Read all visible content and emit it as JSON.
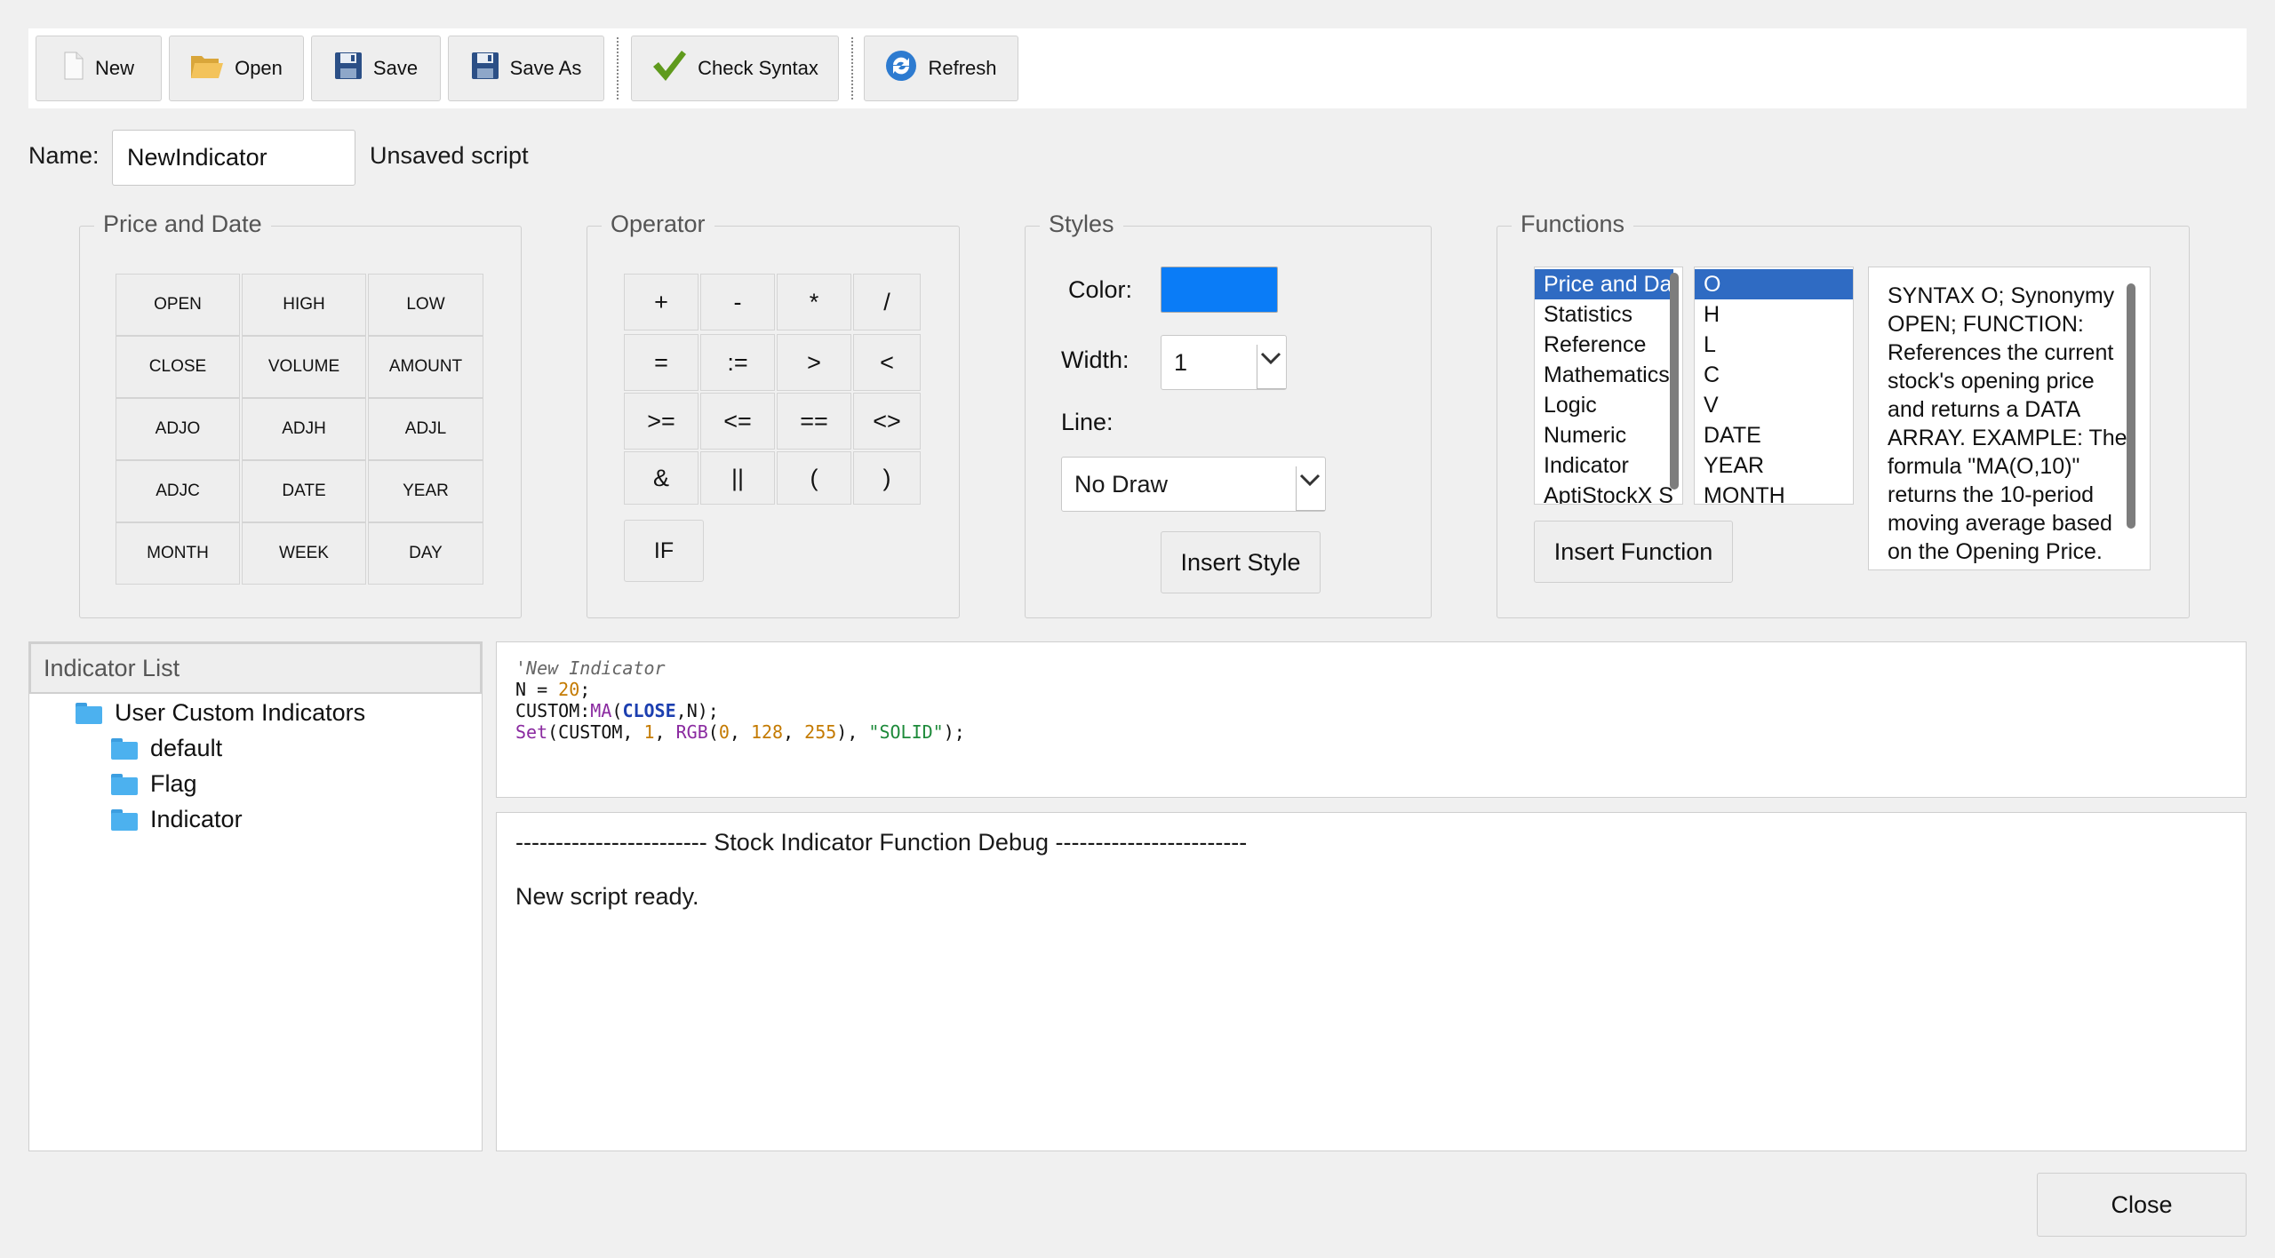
{
  "toolbar": {
    "new_label": "New",
    "open_label": "Open",
    "save_label": "Save",
    "save_as_label": "Save As",
    "check_syntax_label": "Check Syntax",
    "refresh_label": "Refresh"
  },
  "name_row": {
    "label": "Name:",
    "value": "NewIndicator",
    "status": "Unsaved script"
  },
  "price_date": {
    "title": "Price and Date",
    "buttons": [
      "OPEN",
      "HIGH",
      "LOW",
      "CLOSE",
      "VOLUME",
      "AMOUNT",
      "ADJO",
      "ADJH",
      "ADJL",
      "ADJC",
      "DATE",
      "YEAR",
      "MONTH",
      "WEEK",
      "DAY"
    ]
  },
  "operator": {
    "title": "Operator",
    "buttons": [
      "+",
      "-",
      "*",
      "/",
      "=",
      ":=",
      ">",
      "<",
      ">=",
      "<=",
      "==",
      "<>",
      "&",
      "||",
      "(",
      ")"
    ],
    "if_label": "IF"
  },
  "styles": {
    "title": "Styles",
    "color_label": "Color:",
    "color_value": "#0a7cf7",
    "width_label": "Width:",
    "width_value": "1",
    "line_label": "Line:",
    "line_value": "No Draw",
    "insert_label": "Insert Style"
  },
  "functions": {
    "title": "Functions",
    "categories": [
      "Price and Date",
      "Statistics",
      "Reference",
      "Mathematics",
      "Logic",
      "Numeric",
      "Indicator",
      "AptiStockX Sc"
    ],
    "items": [
      "O",
      "H",
      "L",
      "C",
      "V",
      "DATE",
      "YEAR",
      "MONTH"
    ],
    "description_lines": [
      "SYNTAX O; Synonymy",
      "OPEN; FUNCTION:",
      "References the current",
      "stock's opening price",
      "and returns a DATA",
      "ARRAY. EXAMPLE: The",
      "formula \"MA(O,10)\"",
      "returns the 10-period",
      "moving average based",
      "on the Opening Price."
    ],
    "insert_label": "Insert Function"
  },
  "indicator_list": {
    "title": "Indicator List",
    "root": "User Custom Indicators",
    "children": [
      "default",
      "Flag",
      "Indicator"
    ]
  },
  "editor": {
    "line1": "'New Indicator",
    "line2": {
      "a": "N = ",
      "b": "20",
      "c": ";"
    },
    "line3": {
      "a": "CUSTOM:",
      "b": "MA",
      "c": "(",
      "d": "CLOSE",
      "e": ",N);"
    },
    "line4": {
      "a": "Set",
      "b": "(CUSTOM, ",
      "c": "1",
      "d": ", ",
      "e": "RGB",
      "f": "(",
      "g": "0",
      "h": ", ",
      "i": "128",
      "j": ", ",
      "k": "255",
      "l": "), ",
      "m": "\"SOLID\"",
      "n": ");"
    }
  },
  "debug": {
    "header": "------------------------ Stock Indicator Function Debug ------------------------",
    "message": "New script ready."
  },
  "close_label": "Close"
}
